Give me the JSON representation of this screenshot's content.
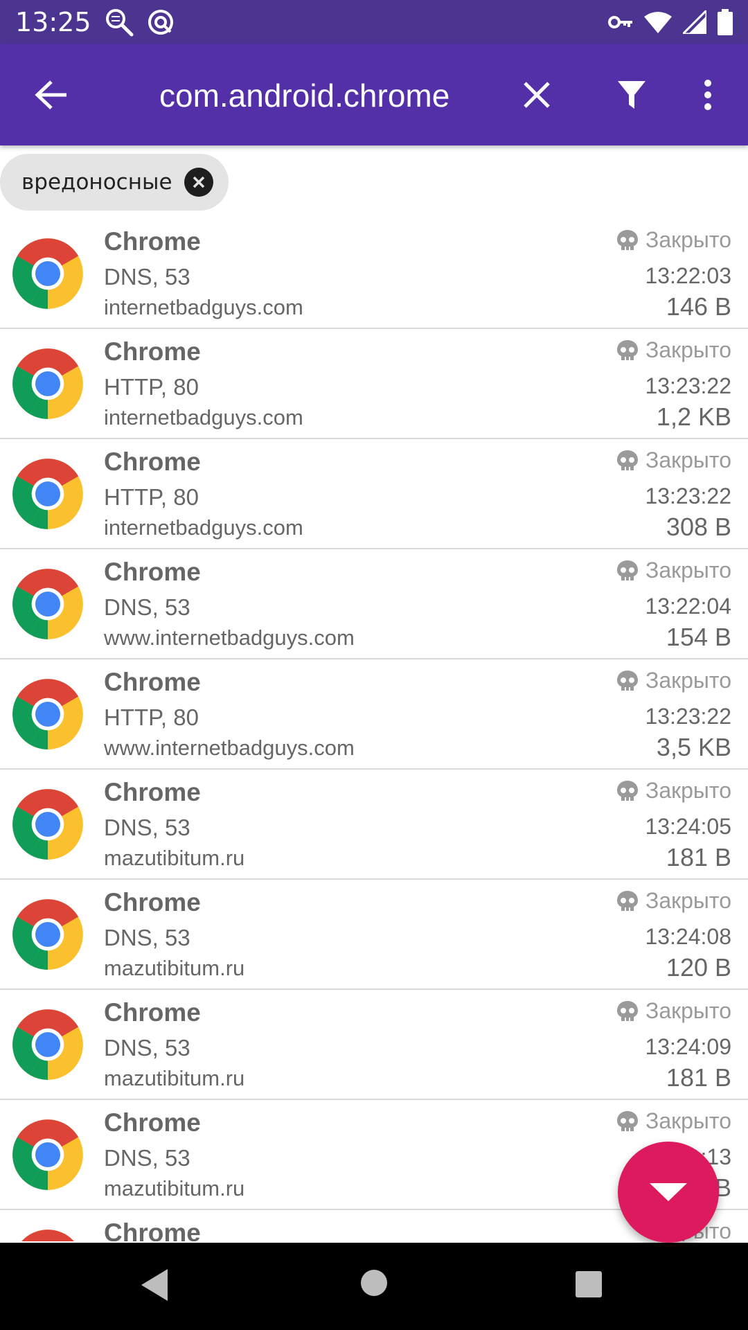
{
  "status_bar": {
    "time": "13:25",
    "left_icons": [
      "search-icon",
      "vpn-network-icon"
    ],
    "right_icons": [
      "key-icon",
      "wifi-icon",
      "signal-icon",
      "battery-icon"
    ]
  },
  "app_bar": {
    "search_value": "com.android.chrome",
    "icons": [
      "back-arrow-icon",
      "close-icon",
      "filter-icon",
      "more-vert-icon"
    ]
  },
  "filter_chip": {
    "label": "вредоносные"
  },
  "list": {
    "items": [
      {
        "title": "Chrome",
        "protocol": "DNS, 53",
        "host": "internetbadguys.com",
        "status": "Закрыто",
        "time": "13:22:03",
        "size": "146 B"
      },
      {
        "title": "Chrome",
        "protocol": "HTTP, 80",
        "host": "internetbadguys.com",
        "status": "Закрыто",
        "time": "13:23:22",
        "size": "1,2 KB"
      },
      {
        "title": "Chrome",
        "protocol": "HTTP, 80",
        "host": "internetbadguys.com",
        "status": "Закрыто",
        "time": "13:23:22",
        "size": "308 B"
      },
      {
        "title": "Chrome",
        "protocol": "DNS, 53",
        "host": "www.internetbadguys.com",
        "status": "Закрыто",
        "time": "13:22:04",
        "size": "154 B"
      },
      {
        "title": "Chrome",
        "protocol": "HTTP, 80",
        "host": "www.internetbadguys.com",
        "status": "Закрыто",
        "time": "13:23:22",
        "size": "3,5 KB"
      },
      {
        "title": "Chrome",
        "protocol": "DNS, 53",
        "host": "mazutibitum.ru",
        "status": "Закрыто",
        "time": "13:24:05",
        "size": "181 B"
      },
      {
        "title": "Chrome",
        "protocol": "DNS, 53",
        "host": "mazutibitum.ru",
        "status": "Закрыто",
        "time": "13:24:08",
        "size": "120 B"
      },
      {
        "title": "Chrome",
        "protocol": "DNS, 53",
        "host": "mazutibitum.ru",
        "status": "Закрыто",
        "time": "13:24:09",
        "size": "181 B"
      },
      {
        "title": "Chrome",
        "protocol": "DNS, 53",
        "host": "mazutibitum.ru",
        "status": "Закрыто",
        "time": ":13",
        "size": "B"
      },
      {
        "title": "Chrome",
        "protocol": "",
        "host": "",
        "status": "рыто",
        "time": "",
        "size": ""
      }
    ]
  },
  "fab": {
    "icon": "arrow-drop-down-icon",
    "color": "#dd1a5e"
  },
  "nav_bar": {
    "icons": [
      "nav-back-icon",
      "nav-home-icon",
      "nav-recents-icon"
    ]
  },
  "colors": {
    "status_bar": "#4b3591",
    "app_bar": "#5330a8",
    "fab": "#dd1a5e"
  }
}
